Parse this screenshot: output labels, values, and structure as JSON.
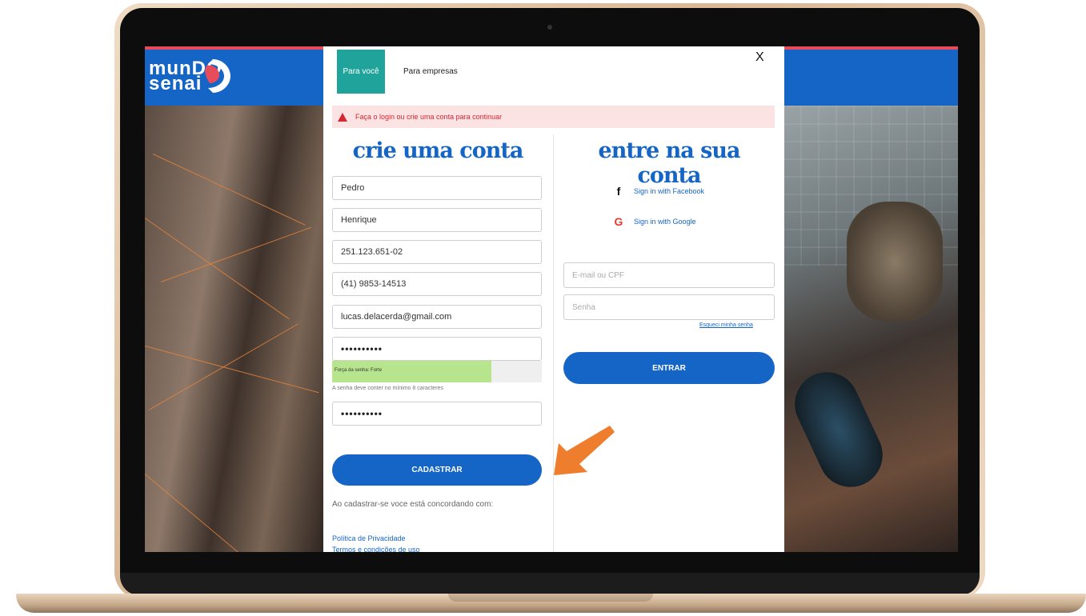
{
  "brand": {
    "logo_line1": "munDO",
    "logo_line2": "senai",
    "primary_color": "#1565c7",
    "accent_color": "#e84c5b"
  },
  "tabs": [
    {
      "label": "Para você",
      "active": true
    },
    {
      "label": "Para empresas",
      "active": false
    }
  ],
  "close_label": "X",
  "alert": {
    "icon": "warning-icon",
    "text": "Faça o login ou crie uma conta para continuar",
    "color": "#d6262f"
  },
  "register": {
    "heading": "crie uma conta",
    "first_name": "Pedro",
    "last_name": "Henrique",
    "cpf": "251.123.651-02",
    "phone": "(41) 9853-14513",
    "email": "lucas.delacerda@gmail.com",
    "password": "••••••••••",
    "strength_label": "Força da senha: Forte",
    "strength_fraction": 0.76,
    "password_hint": "A senha deve conter no mínimo 8 caracteres",
    "password_confirm": "••••••••••",
    "submit_label": "CADASTRAR",
    "consent_text": "Ao cadastrar-se voce está concordando com:",
    "privacy_link": "Política de Privacidade",
    "terms_link": "Termos e condições de uso"
  },
  "login": {
    "heading": "entre na sua conta",
    "facebook_label": "Sign in with Facebook",
    "google_label": "Sign in with Google",
    "email_placeholder": "E-mail ou CPF",
    "password_placeholder": "Senha",
    "forgot_label": "Esqueci minha senha",
    "submit_label": "ENTRAR"
  },
  "annotation": {
    "arrow_color": "#ee7d2e"
  }
}
